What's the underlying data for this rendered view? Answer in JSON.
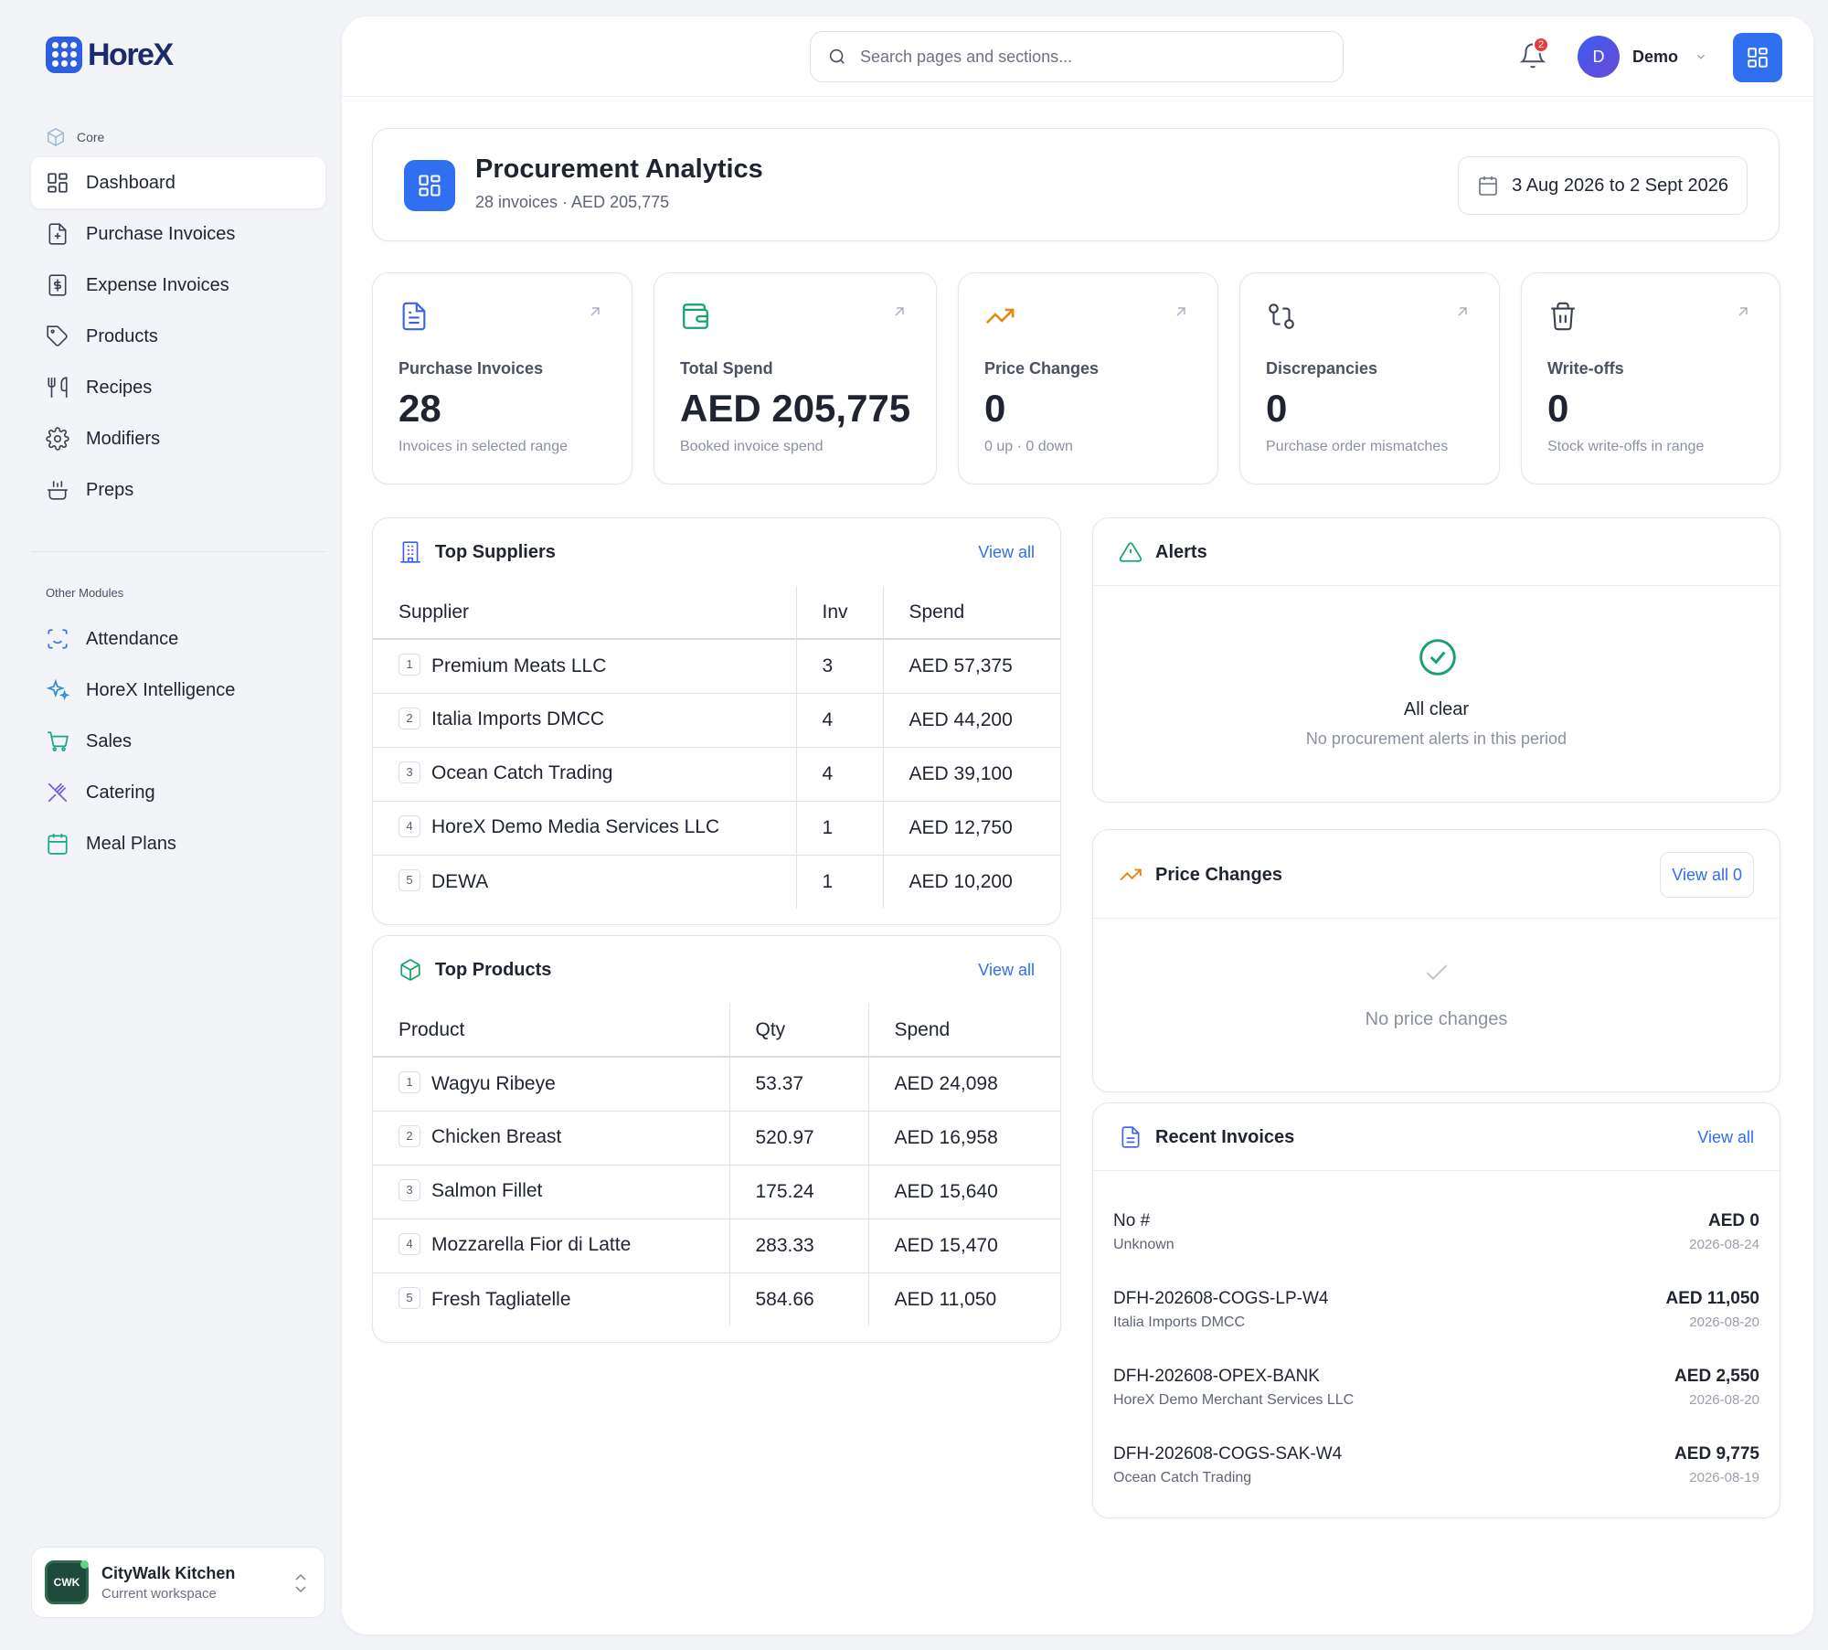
{
  "app": {
    "logo_text": "HoreX"
  },
  "sidebar": {
    "core_label": "Core",
    "core_items": [
      {
        "label": "Dashboard",
        "icon": "dashboard-icon"
      },
      {
        "label": "Purchase Invoices",
        "icon": "invoice-plus-icon"
      },
      {
        "label": "Expense Invoices",
        "icon": "dollar-receipt-icon"
      },
      {
        "label": "Products",
        "icon": "tag-icon"
      },
      {
        "label": "Recipes",
        "icon": "utensils-icon"
      },
      {
        "label": "Modifiers",
        "icon": "gear-icon"
      },
      {
        "label": "Preps",
        "icon": "cooking-pot-icon"
      }
    ],
    "other_label": "Other Modules",
    "other_items": [
      {
        "label": "Attendance",
        "icon": "face-scan-icon"
      },
      {
        "label": "HoreX Intelligence",
        "icon": "sparkles-icon"
      },
      {
        "label": "Sales",
        "icon": "cart-icon"
      },
      {
        "label": "Catering",
        "icon": "cutlery-cross-icon"
      },
      {
        "label": "Meal Plans",
        "icon": "calendar-icon"
      }
    ],
    "workspace": {
      "logo": "CWK",
      "name": "CityWalk Kitchen",
      "sub": "Current workspace"
    }
  },
  "topbar": {
    "search_placeholder": "Search pages and sections...",
    "notification_count": "2",
    "user_initial": "D",
    "user_name": "Demo"
  },
  "header": {
    "title": "Procurement Analytics",
    "subtitle": "28 invoices · AED 205,775",
    "date_range": "3 Aug 2026 to 2 Sept 2026"
  },
  "stats": [
    {
      "label": "Purchase Invoices",
      "value": "28",
      "sub": "Invoices in selected range",
      "icon": "document-icon",
      "color": "#3b5ff0"
    },
    {
      "label": "Total Spend",
      "value": "AED 205,775",
      "sub": "Booked invoice spend",
      "icon": "wallet-icon",
      "color": "#16a36b"
    },
    {
      "label": "Price Changes",
      "value": "0",
      "sub": "0 up · 0 down",
      "icon": "trending-up-icon",
      "color": "#e38a12"
    },
    {
      "label": "Discrepancies",
      "value": "0",
      "sub": "Purchase order mismatches",
      "icon": "git-compare-icon",
      "color": "#3b4152"
    },
    {
      "label": "Write-offs",
      "value": "0",
      "sub": "Stock write-offs in range",
      "icon": "trash-icon",
      "color": "#3b4152"
    }
  ],
  "top_suppliers": {
    "title": "Top Suppliers",
    "link": "View all",
    "columns": [
      "Supplier",
      "Inv",
      "Spend"
    ],
    "rows": [
      {
        "rank": "1",
        "name": "Premium Meats LLC",
        "count": "3",
        "spend": "AED 57,375"
      },
      {
        "rank": "2",
        "name": "Italia Imports DMCC",
        "count": "4",
        "spend": "AED 44,200"
      },
      {
        "rank": "3",
        "name": "Ocean Catch Trading",
        "count": "4",
        "spend": "AED 39,100"
      },
      {
        "rank": "4",
        "name": "HoreX Demo Media Services LLC",
        "count": "1",
        "spend": "AED 12,750"
      },
      {
        "rank": "5",
        "name": "DEWA",
        "count": "1",
        "spend": "AED 10,200"
      }
    ]
  },
  "top_products": {
    "title": "Top Products",
    "link": "View all",
    "columns": [
      "Product",
      "Qty",
      "Spend"
    ],
    "rows": [
      {
        "rank": "1",
        "name": "Wagyu Ribeye",
        "count": "53.37",
        "spend": "AED 24,098"
      },
      {
        "rank": "2",
        "name": "Chicken Breast",
        "count": "520.97",
        "spend": "AED 16,958"
      },
      {
        "rank": "3",
        "name": "Salmon Fillet",
        "count": "175.24",
        "spend": "AED 15,640"
      },
      {
        "rank": "4",
        "name": "Mozzarella Fior di Latte",
        "count": "283.33",
        "spend": "AED 15,470"
      },
      {
        "rank": "5",
        "name": "Fresh Tagliatelle",
        "count": "584.66",
        "spend": "AED 11,050"
      }
    ]
  },
  "alerts": {
    "title": "Alerts",
    "status": "All clear",
    "message": "No procurement alerts in this period"
  },
  "price_changes": {
    "title": "Price Changes",
    "link": "View all 0",
    "empty": "No price changes"
  },
  "recent_invoices": {
    "title": "Recent Invoices",
    "link": "View all",
    "items": [
      {
        "number": "No #",
        "supplier": "Unknown",
        "amount": "AED 0",
        "date": "2026-08-24"
      },
      {
        "number": "DFH-202608-COGS-LP-W4",
        "supplier": "Italia Imports DMCC",
        "amount": "AED 11,050",
        "date": "2026-08-20"
      },
      {
        "number": "DFH-202608-OPEX-BANK",
        "supplier": "HoreX Demo Merchant Services LLC",
        "amount": "AED 2,550",
        "date": "2026-08-20"
      },
      {
        "number": "DFH-202608-COGS-SAK-W4",
        "supplier": "Ocean Catch Trading",
        "amount": "AED 9,775",
        "date": "2026-08-19"
      }
    ]
  }
}
